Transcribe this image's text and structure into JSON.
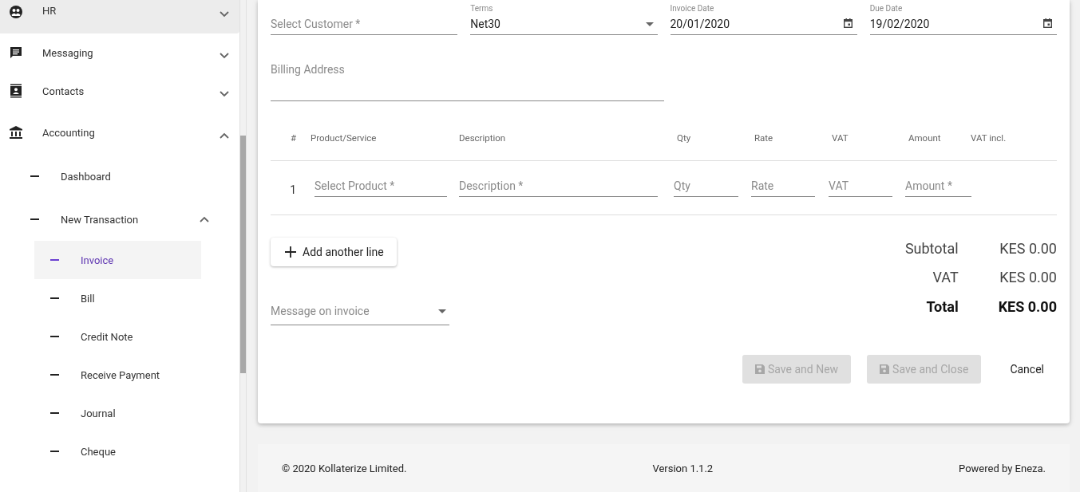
{
  "sidebar": {
    "items": [
      {
        "label": "HR",
        "kind": "hr",
        "expanded": false,
        "highlighted": true
      },
      {
        "label": "Messaging",
        "kind": "messaging",
        "expanded": false,
        "highlighted": false
      },
      {
        "label": "Contacts",
        "kind": "contacts",
        "expanded": false,
        "highlighted": false
      },
      {
        "label": "Accounting",
        "kind": "accounting",
        "expanded": true,
        "highlighted": false,
        "children": [
          {
            "label": "Dashboard",
            "selected": false
          },
          {
            "label": "New Transaction",
            "expanded": true,
            "children": [
              {
                "label": "Invoice",
                "selected": true
              },
              {
                "label": "Bill",
                "selected": false
              },
              {
                "label": "Credit Note",
                "selected": false
              },
              {
                "label": "Receive Payment",
                "selected": false
              },
              {
                "label": "Journal",
                "selected": false
              },
              {
                "label": "Cheque",
                "selected": false
              }
            ]
          }
        ]
      }
    ]
  },
  "form": {
    "fields": [
      {
        "kind": "text",
        "placeholder": "Select Customer *"
      },
      {
        "kind": "select",
        "label": "Terms",
        "value": "Net30"
      },
      {
        "kind": "date",
        "label": "Invoice Date",
        "value": "20/01/2020"
      },
      {
        "kind": "date",
        "label": "Due Date",
        "value": "19/02/2020"
      }
    ],
    "billing_address": {
      "placeholder": "Billing Address"
    },
    "line_items": {
      "columns": [
        "#",
        "Product/Service",
        "Description",
        "Qty",
        "Rate",
        "VAT",
        "Amount",
        "VAT incl."
      ],
      "rows": [
        {
          "number": "1",
          "placeholders": [
            "Select Product *",
            "Description *",
            "Qty",
            "Rate",
            "VAT",
            "Amount *"
          ]
        }
      ]
    },
    "add_line_button": "Add another line",
    "totals": [
      {
        "label": "Subtotal",
        "value": "KES 0.00",
        "bold": false
      },
      {
        "label": "VAT",
        "value": "KES 0.00",
        "bold": false
      },
      {
        "label": "Total",
        "value": "KES 0.00",
        "bold": true
      }
    ],
    "message_select": {
      "placeholder": "Message on invoice"
    },
    "actions": [
      {
        "label": "Save and New",
        "kind": "save",
        "disabled": true
      },
      {
        "label": "Save and Close",
        "kind": "save",
        "disabled": true
      },
      {
        "label": "Cancel",
        "kind": "text",
        "disabled": false
      }
    ]
  },
  "footer": {
    "copyright": "© 2020 Kollaterize Limited.",
    "version": "Version 1.1.2",
    "powered_by": "Powered by Eneza."
  }
}
